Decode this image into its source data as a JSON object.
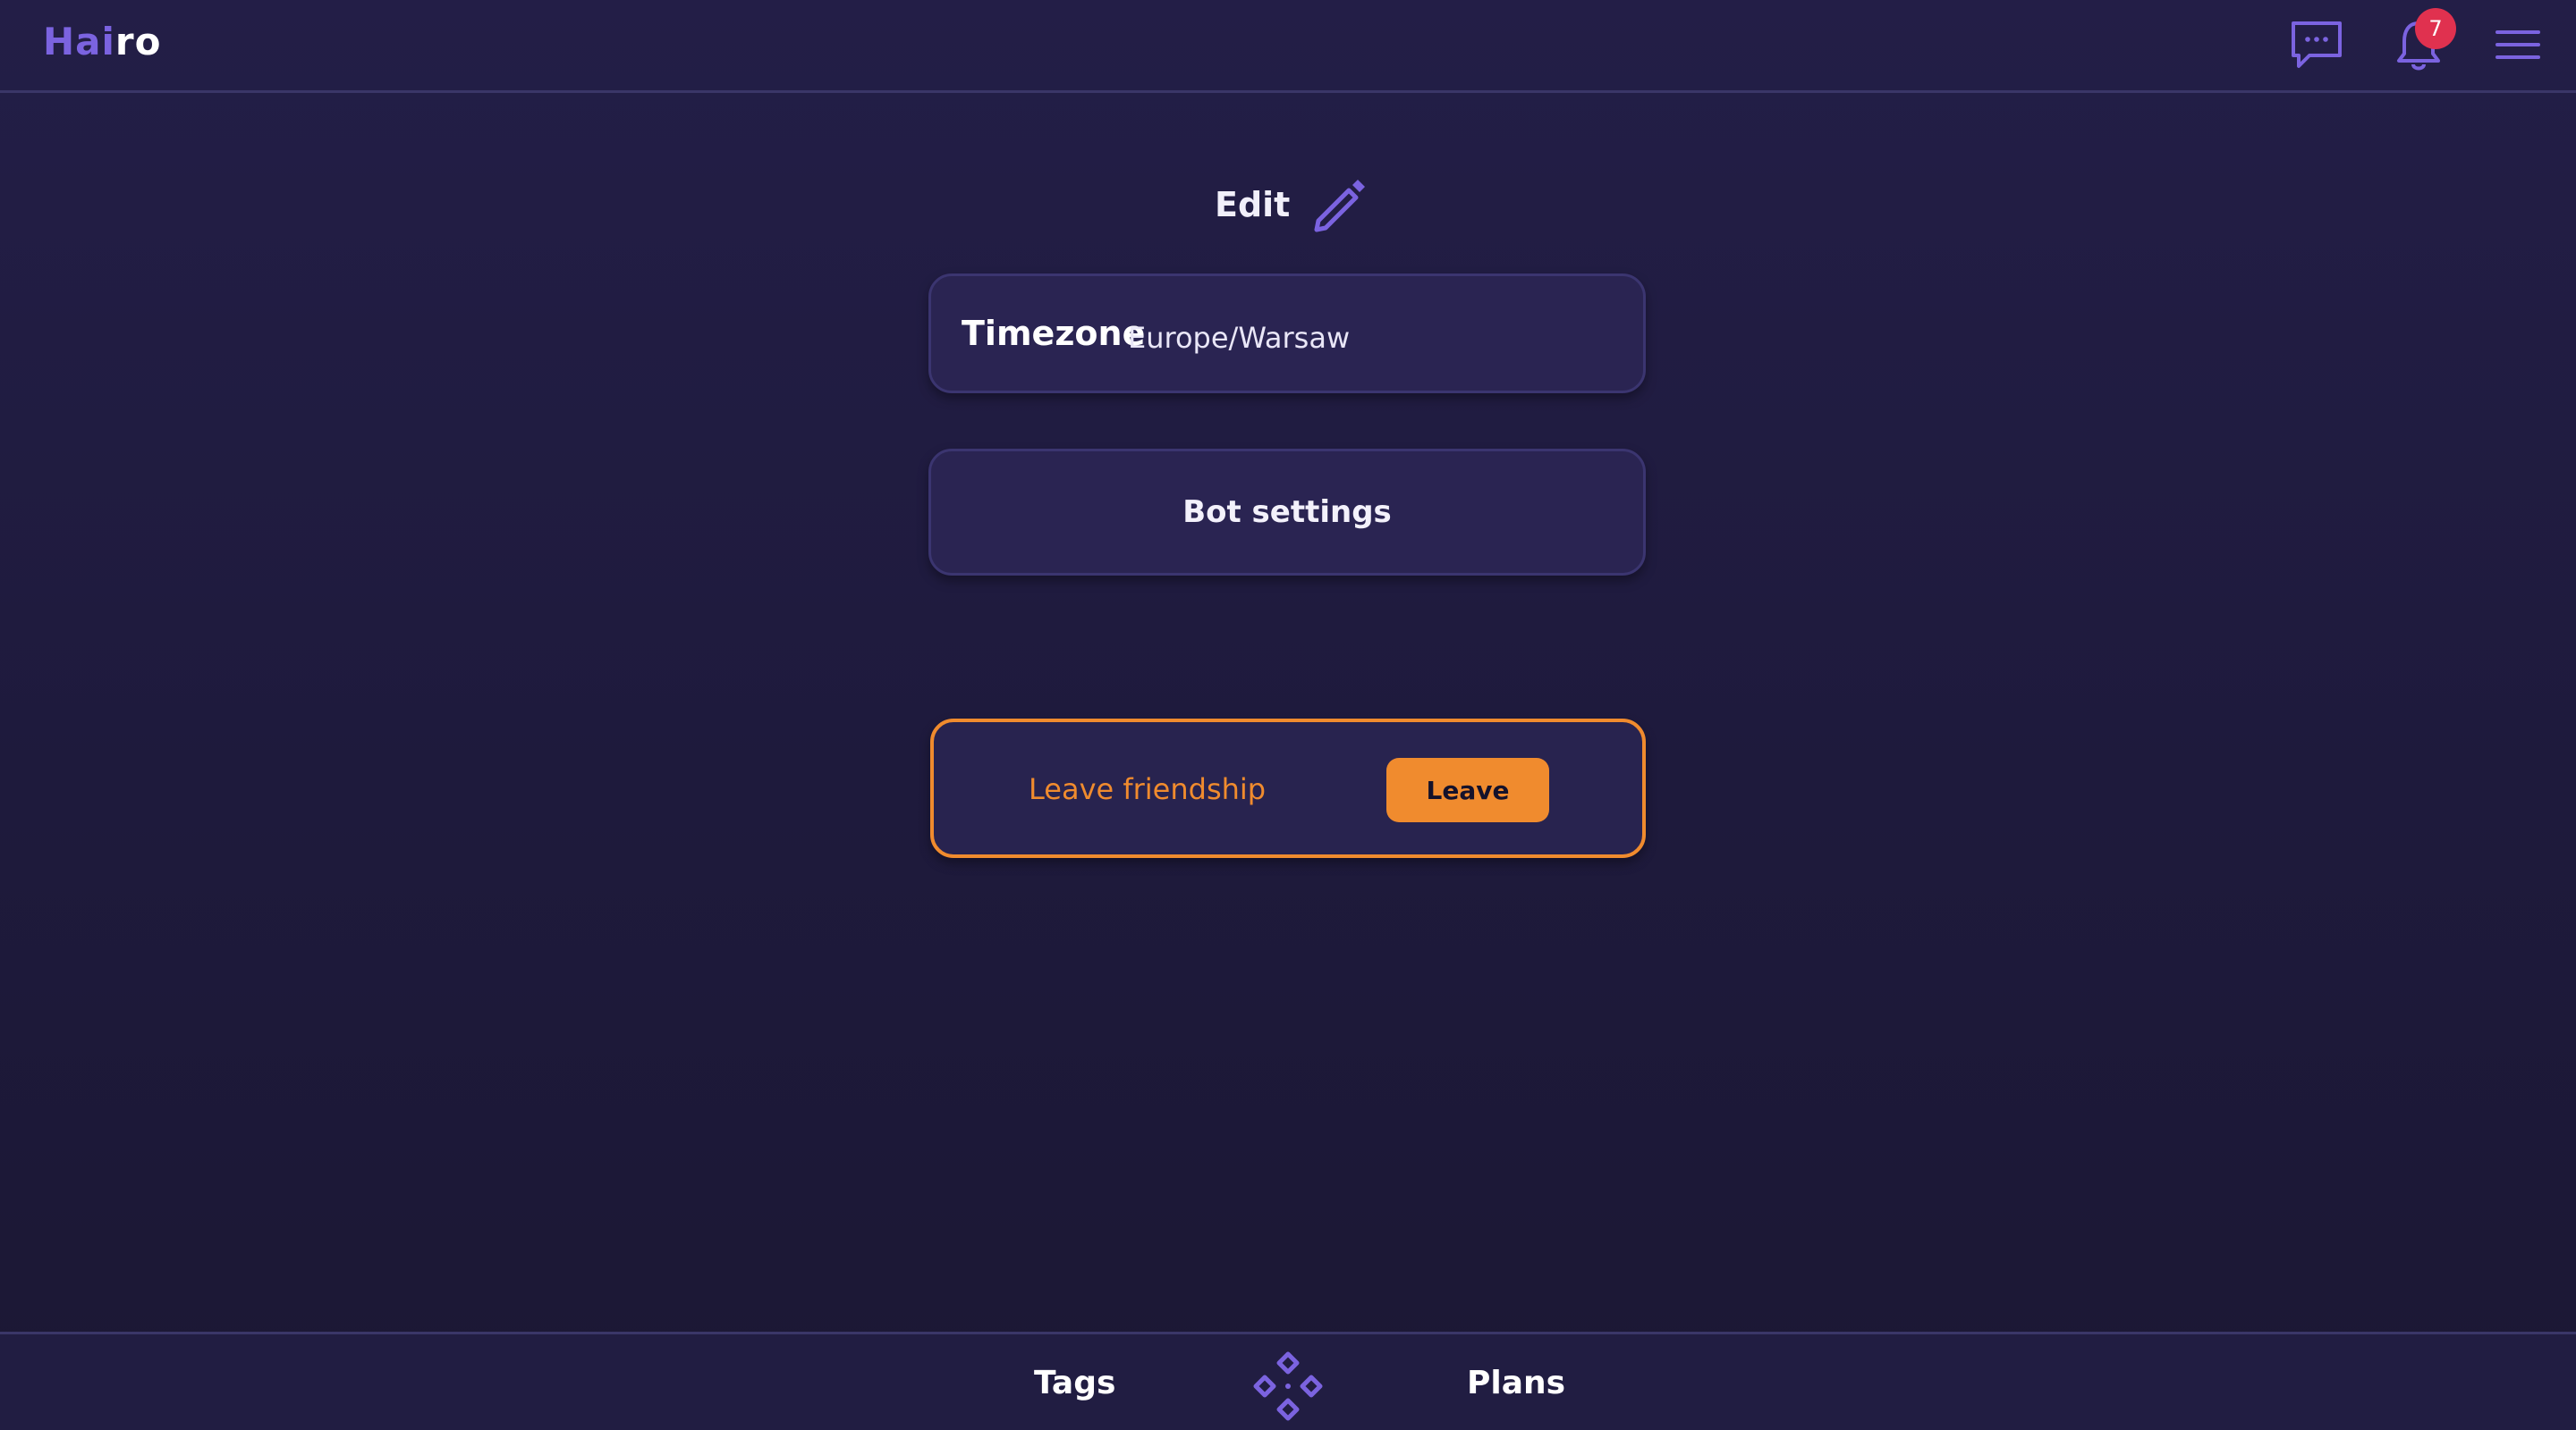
{
  "header": {
    "logo_part1": "Hai",
    "logo_part2": "ro",
    "icons": {
      "messages": "chat-bubble-icon",
      "notifications": "bell-icon",
      "menu": "hamburger-menu-icon"
    },
    "notification_count": "7"
  },
  "main": {
    "edit_label": "Edit",
    "edit_icon": "pencil-icon",
    "timezone": {
      "label": "Timezone",
      "value": "Europe/Warsaw"
    },
    "bot_settings_label": "Bot settings",
    "leave": {
      "text": "Leave friendship",
      "button_label": "Leave"
    }
  },
  "bottom_nav": {
    "tags_label": "Tags",
    "home_icon": "diamond-cluster-icon",
    "plans_label": "Plans"
  },
  "colors": {
    "background": "#231e47",
    "accent_purple": "#7b63e0",
    "accent_orange": "#f08b2e",
    "badge_red": "#e0314f",
    "card_bg": "#2a2452"
  }
}
